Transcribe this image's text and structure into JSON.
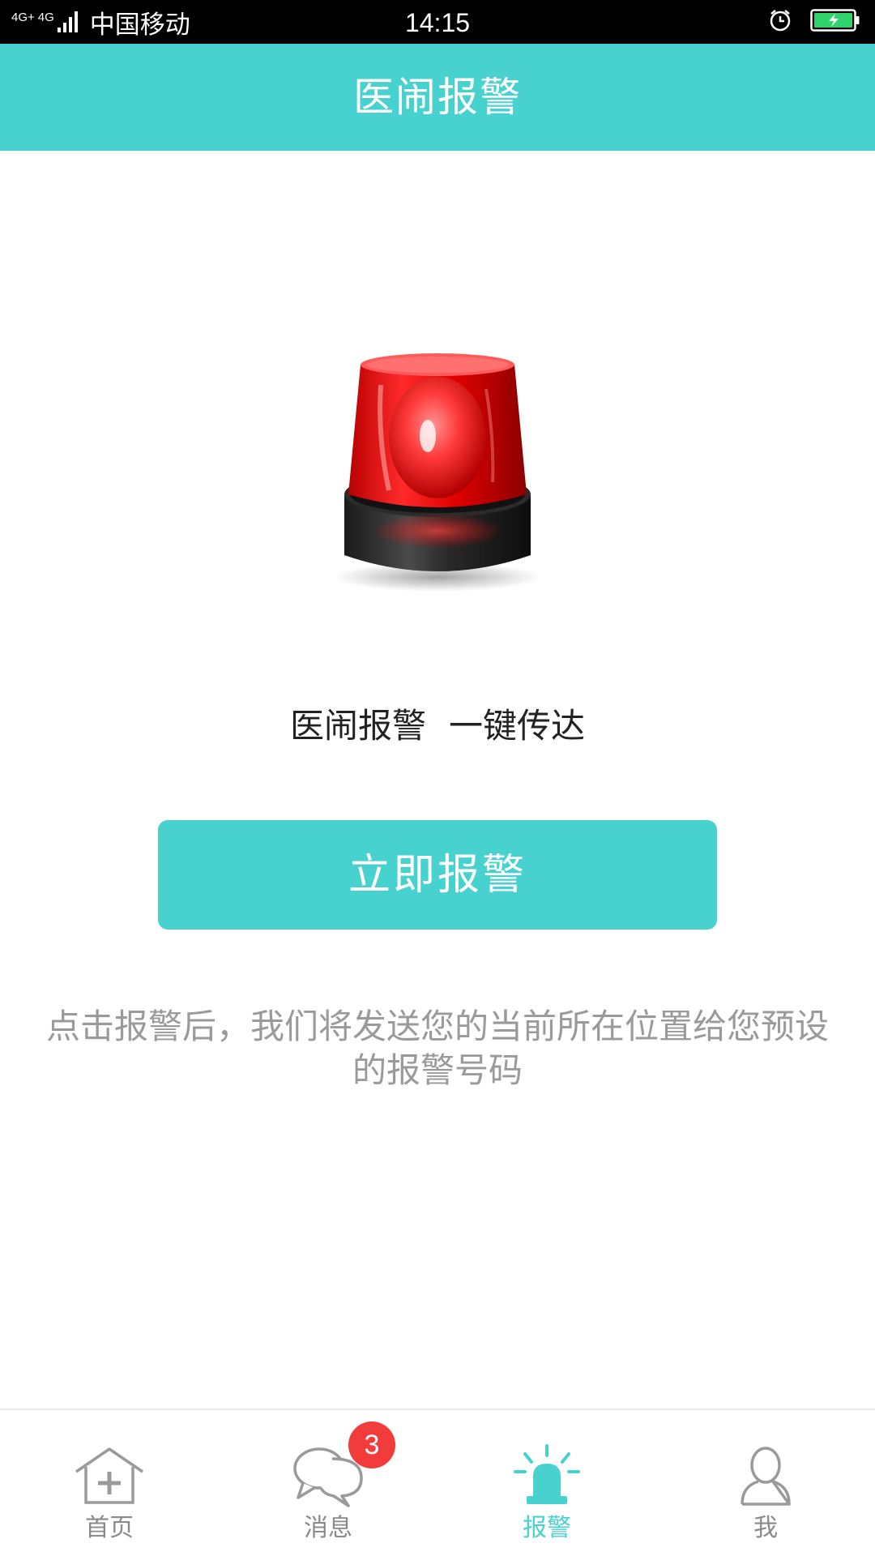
{
  "status_bar": {
    "network_label_1": "4G+",
    "network_label_2": "4G",
    "carrier": "中国移动",
    "time": "14:15",
    "alarm_icon": "alarm-clock-icon",
    "battery_icon": "battery-charging-icon",
    "battery_color": "#2fd36b"
  },
  "header": {
    "title": "医闹报警",
    "background": "#48d2cf"
  },
  "main": {
    "siren_icon": "siren-light-icon",
    "slogan_part1": "医闹报警",
    "slogan_part2": "一键传达",
    "alarm_button_label": "立即报警",
    "hint": "点击报警后，我们将发送您的当前所在位置给您预设的报警号码"
  },
  "bottom_nav": {
    "items": [
      {
        "label": "首页",
        "icon": "home-plus-icon",
        "active": false
      },
      {
        "label": "消息",
        "icon": "chat-bubbles-icon",
        "active": false,
        "badge": "3"
      },
      {
        "label": "报警",
        "icon": "siren-icon",
        "active": true
      },
      {
        "label": "我",
        "icon": "user-icon",
        "active": false
      }
    ],
    "active_color": "#48d2cf",
    "badge_color": "#f23c3c"
  }
}
